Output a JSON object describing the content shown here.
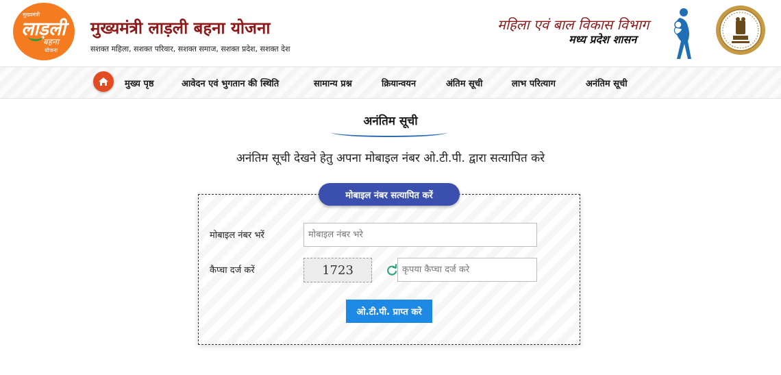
{
  "header": {
    "logo": {
      "text_top": "मुख्यमंत्री",
      "text_main": "लाड़ली",
      "text_sub": "बहना",
      "text_bottom": "योजना"
    },
    "title": "मुख्यमंत्री लाड़ली बहना योजना",
    "tagline": "सशक्त महिला, सशक्त परिवार, सशक्त समाज, सशक्त प्रदेश, सशक्त देश",
    "department": "महिला एवं बाल विकास विभाग",
    "government": "मध्य प्रदेश शासन"
  },
  "nav": {
    "items": [
      {
        "label": "मुख्य पृष्ठ"
      },
      {
        "label": "आवेदन एवं भुगतान की स्थिति"
      },
      {
        "label": "सामान्य प्रश्न"
      },
      {
        "label": "क्रियान्वयन"
      },
      {
        "label": "अंतिम सूची"
      },
      {
        "label": "लाभ परित्याग"
      },
      {
        "label": "अनंतिम सूची"
      }
    ]
  },
  "page": {
    "title": "अनंतिम सूची",
    "instruction": "अनंतिम सूची देखने हेतु अपना मोबाइल नंबर ओ.टी.पी. द्वारा सत्यापित करे"
  },
  "form": {
    "heading": "मोबाइल नंबर सत्यापित करें",
    "mobile_label": "मोबाइल नंबर भरें",
    "mobile_placeholder": "मोबाइल नंबर भरे",
    "mobile_value": "",
    "captcha_label": "कैप्चा दर्ज करें",
    "captcha_value": "1723",
    "captcha_placeholder": "कृपया कैप्चा दर्ज करे",
    "submit_label": "ओ.टी.पी. प्राप्त करे"
  },
  "colors": {
    "brand_orange": "#f47b20",
    "title_maroon": "#8b1a1a",
    "pill_blue": "#3a4fae",
    "button_blue": "#1e88e5",
    "home_red": "#e34c23"
  },
  "icons": {
    "home": "home-icon",
    "refresh": "refresh-icon",
    "emblem": "mp-emblem-icon",
    "mother_child": "mother-child-icon"
  }
}
